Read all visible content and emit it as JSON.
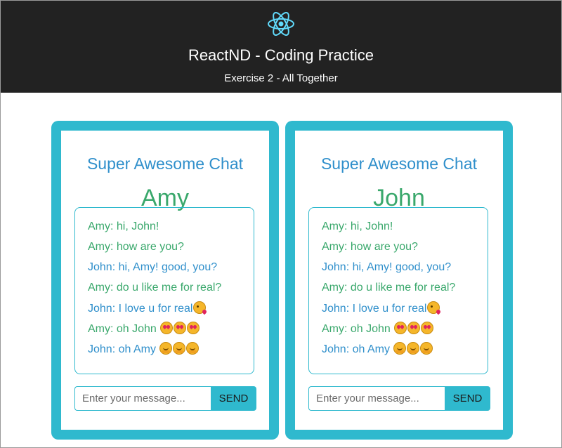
{
  "header": {
    "logo_icon": "react-atom-icon",
    "title": "ReactND - Coding Practice",
    "subtitle": "Exercise 2 - All Together"
  },
  "colors": {
    "header_bg": "#222222",
    "window_border": "#2fb9ce",
    "heading_blue": "#2f8fcb",
    "amy_green": "#3aa86c",
    "send_button_bg": "#2fb9ce"
  },
  "chats": [
    {
      "heading": "Super Awesome Chat",
      "user": "Amy",
      "input": {
        "value": "",
        "placeholder": "Enter your message..."
      },
      "send_label": "SEND",
      "messages": [
        {
          "text": "Amy: hi, John!",
          "emoji": []
        },
        {
          "text": "Amy: how are you?",
          "emoji": []
        },
        {
          "text": "John: hi, Amy! good, you?",
          "emoji": []
        },
        {
          "text": "Amy: do u like me for real?",
          "emoji": []
        },
        {
          "text": "John: I love u for real",
          "emoji": [
            "face-blowing-kiss-emoji"
          ]
        },
        {
          "text": "Amy: oh John ",
          "emoji": [
            "heart-eyes-emoji",
            "heart-eyes-emoji",
            "heart-eyes-emoji"
          ]
        },
        {
          "text": "John: oh Amy ",
          "emoji": [
            "hugging-face-emoji",
            "hugging-face-emoji",
            "hugging-face-emoji"
          ]
        }
      ]
    },
    {
      "heading": "Super Awesome Chat",
      "user": "John",
      "input": {
        "value": "",
        "placeholder": "Enter your message..."
      },
      "send_label": "SEND",
      "messages": [
        {
          "text": "Amy: hi, John!",
          "emoji": []
        },
        {
          "text": "Amy: how are you?",
          "emoji": []
        },
        {
          "text": "John: hi, Amy! good, you?",
          "emoji": []
        },
        {
          "text": "Amy: do u like me for real?",
          "emoji": []
        },
        {
          "text": "John: I love u for real",
          "emoji": [
            "face-blowing-kiss-emoji"
          ]
        },
        {
          "text": "Amy: oh John ",
          "emoji": [
            "heart-eyes-emoji",
            "heart-eyes-emoji",
            "heart-eyes-emoji"
          ]
        },
        {
          "text": "John: oh Amy ",
          "emoji": [
            "hugging-face-emoji",
            "hugging-face-emoji",
            "hugging-face-emoji"
          ]
        }
      ]
    }
  ]
}
